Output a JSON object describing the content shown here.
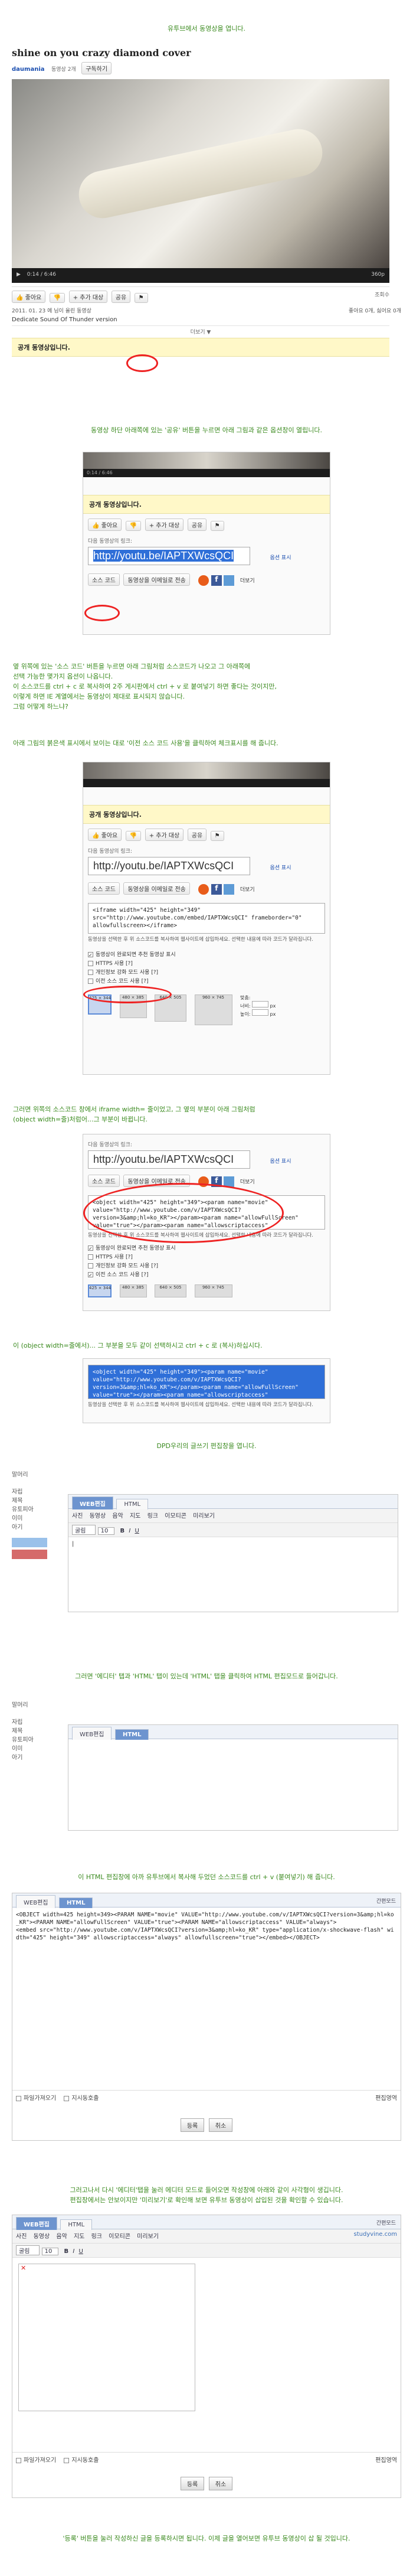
{
  "step1": {
    "caption": "유투브에서 동영상을 엽니다.",
    "video_title": "shine on you crazy diamond cover",
    "channel": "daumania",
    "video_count": "동영상 2개",
    "subscribe": "구독하기",
    "time": "0:14 / 6:46",
    "player_right": "360p",
    "like": "좋아요",
    "add_to": "추가 대상",
    "share": "공유",
    "views_label": "조회수",
    "date": "2011. 01. 23 에",
    "uploader": "님이 올린 동영상",
    "description": "Dedicate Sound Of Thunder version",
    "more": "더보기",
    "right_meta": "좋아요 0개, 싫어요 0개",
    "share_header": "공개 동영상입니다."
  },
  "step2": {
    "caption": "동영상 하단 아래쪽에 있는 '공유' 버튼을 누르면 아래 그림과 같은 옵션창이 열립니다.",
    "time": "0:14 / 6:46",
    "share_header": "공개 동영상입니다.",
    "like": "좋아요",
    "add_to": "추가 대상",
    "share": "공유",
    "link_label": "다음 동영상의 링크:",
    "url": "http://youtu.be/IAPTXWcsQCI",
    "options": "옵션 표시",
    "source_code": "소스 코드",
    "email": "동영상을 이메일로 전송",
    "more": "더보기"
  },
  "step3": {
    "captions": [
      "옆 위쪽에 있는 '소스 코드' 버튼을 누르면 아래 그림처럼 소스코드가 나오고 그 아래쪽에",
      "선택 가능한 몇가지 옵션이 나옵니다.",
      "이 소스코드를 ctrl + c 로 복사하여 2주 게시판에서 ctrl + v 로 붙여넣기 하면 좋다는 것이지만,",
      "이렇게 하면 IE 계열에서는 동영상이 제대로 표시되지 않습니다.",
      "그럼 어떻게 하느냐?"
    ]
  },
  "step4": {
    "caption": "아래 그림의 붉은색 표시에서 보이는 대로 '이전 소스 코드 사용'을 클릭하여 체크표시를 해 줍니다.",
    "share_header": "공개 동영상입니다.",
    "like": "좋아요",
    "add_to": "추가 대상",
    "share": "공유",
    "link_label": "다음 동영상의 링크:",
    "url": "http://youtu.be/IAPTXWcsQCI",
    "options": "옵션 표시",
    "source_code": "소스 코드",
    "email": "동영상을 이메일로 전송",
    "more": "더보기",
    "code": "<iframe width=\"425\" height=\"349\"\nsrc=\"http://www.youtube.com/embed/IAPTXWcsQCI\" frameborder=\"0\"\nallowfullscreen></iframe>",
    "hint": "동영상을 선택한 후 위 소스코드를 복사하여 웹사이트에 삽입하세요. 선택한 내용에 따라 코드가 달라집니다.",
    "opt1": "동영상이 완료되면 추천 동영상 표시",
    "opt2": "HTTPS 사용 [?]",
    "opt3": "개인정보 강화 모드 사용 [?]",
    "opt4": "이전 소스 코드 사용 [?]",
    "sizes": [
      "425 × 344",
      "480 × 385",
      "640 × 505",
      "960 × 745"
    ],
    "custom_label": "맞춤:",
    "width_label": "너비:",
    "height_label": "높이:",
    "px": "px"
  },
  "step5": {
    "caption1": "그러면 위쪽의 소스코드 창에서 iframe width= 줄이었고, 그 옆의 부분이 아래 그림처럼",
    "caption2": "(object width=줄)처럼어...그 부분이 바뀝니다.",
    "link_label": "다음 동영상의 링크:",
    "url": "http://youtu.be/IAPTXWcsQCI",
    "options": "옵션 표시",
    "source_code": "소스 코드",
    "email": "동영상을 이메일로 전송",
    "more": "더보기",
    "code": "<object width=\"425\" height=\"349\"><param name=\"movie\"\nvalue=\"http://www.youtube.com/v/IAPTXWcsQCI?\nversion=3&amp;hl=ko_KR\"></param><param name=\"allowFullScreen\"\nvalue=\"true\"></param><param name=\"allowscriptaccess\"",
    "hint": "동영상을 선택한 후 위 소스코드를 복사하여 웹사이트에 삽입하세요. 선택한 내용에 따라 코드가 달라집니다.",
    "opt1": "동영상이 완료되면 추천 동영상 표시",
    "opt2": "HTTPS 사용 [?]",
    "opt3": "개인정보 강화 모드 사용 [?]",
    "opt4": "이전 소스 코드 사용 [?]",
    "sizes": [
      "425 × 344",
      "480 × 385",
      "640 × 505",
      "960 × 745"
    ],
    "width_label": "너비:",
    "height_label": "높이:",
    "px": "px"
  },
  "step6": {
    "caption": "이 (object width=줄에서)... 그 부분을 모두 같이 선택하시고 ctrl + c 로 (복사)하십시다.",
    "code": "<object width=\"425\" height=\"349\"><param name=\"movie\"\nvalue=\"http://www.youtube.com/v/IAPTXWcsQCI?\nversion=3&amp;hl=ko_KR\"></param><param name=\"allowFullScreen\"\nvalue=\"true\"></param><param name=\"allowscriptaccess\"",
    "hint": "동영상을 선택한 후 위 소스코드를 복사하여 웹사이트에 삽입하세요. 선택한 내용에 따라 코드가 달라집니다."
  },
  "step7": {
    "caption": "DPD우리의 글쓰기 편집창을 엽니다.",
    "side_items": [
      "말머리",
      "",
      "자립",
      "제목",
      "유토피아",
      "이미",
      "아기"
    ],
    "tab_wysiwyg": "WEB편집",
    "tab_html": "HTML",
    "toolbar": [
      "사진",
      "동영상",
      "음악",
      "지도",
      "링크",
      "이모티콘",
      "미리보기"
    ],
    "font": "굴림",
    "size": "10"
  },
  "step8": {
    "caption": "그러면 '에디터' 탭과 'HTML' 탭이 있는데 'HTML' 탭을 클릭하여 HTML 편집모드로 들어갑니다.",
    "side_items": [
      "말머리",
      "",
      "자립",
      "제목",
      "유토피아",
      "이미",
      "아기"
    ],
    "tab_wysiwyg": "WEB편집",
    "tab_html": "HTML"
  },
  "step9": {
    "caption": "이 HTML 편집창에 아까 유투브에서 복사해 두었던 소스코드를 ctrl + v (붙여넣기) 해 줍니다.",
    "tab_wysiwyg": "WEB편집",
    "tab_html": "HTML",
    "right_tab": "간편모드",
    "code": "<OBJECT width=425 height=349><PARAM NAME=\"movie\" VALUE=\"http://www.youtube.com/v/IAPTXWcsQCI?version=3&amp;hl=ko_KR\"><PARAM NAME=\"allowFullScreen\" VALUE=\"true\"><PARAM NAME=\"allowscriptaccess\" VALUE=\"always\">\n<embed src=\"http://www.youtube.com/v/IAPTXWcsQCI?version=3&amp;hl=ko_KR\" type=\"application/x-shockwave-flash\" width=\"425\" height=\"349\" allowscriptaccess=\"always\" allowfullscreen=\"true\"></embed></OBJECT>",
    "opt_a": "파일가져오기",
    "opt_b": "지시동호출",
    "edit_area": "편집영역",
    "ok": "등록",
    "cancel": "취소"
  },
  "step10": {
    "caption1": "그러고나서 다시 '에디터'탭을 눌러 에디터 모드로 들어오면 작성창에 아래와 같이 사각형이 생깁니다.",
    "caption2": "편집창에서는 안보이지만 '미리보기'로 확인해 보면 유투브 동영상이 삽입된 것을 확인할 수 있습니다.",
    "tab_wysiwyg": "WEB편집",
    "tab_html": "HTML",
    "right_tab": "간편모드",
    "toolbar": [
      "사진",
      "동영상",
      "음악",
      "지도",
      "링크",
      "이모티콘",
      "미리보기"
    ],
    "font": "굴림",
    "size": "10",
    "opt_a": "파일가져오기",
    "opt_b": "지시동호출",
    "edit_area": "편집영역",
    "ok": "등록",
    "cancel": "취소",
    "brand": "studyvine.com"
  },
  "final": {
    "caption": "'등록' 버튼을 눌러 작성하신 글을 등록하시면 됩니다. 이제 글을 열어보면 유투브 동영상이 삽 될 것입니다."
  },
  "colors": {
    "caption_green": "#3a8a1e",
    "highlight_red": "#e22222",
    "selection_blue": "#2f6fd8"
  }
}
